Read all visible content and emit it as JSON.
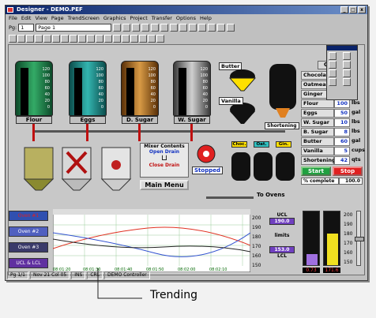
{
  "window": {
    "title": "Designer - DEMO.PEF",
    "min": "_",
    "max": "□",
    "close": "x"
  },
  "menu": [
    "File",
    "Edit",
    "View",
    "Page",
    "TrendScreen",
    "Graphics",
    "Project",
    "Transfer",
    "Options",
    "Help"
  ],
  "toolbar": {
    "page_label": "Pg:",
    "page_num": "1",
    "page_name": "Page 1"
  },
  "tanks": [
    {
      "label": "Flour",
      "color": "#1f7a4a"
    },
    {
      "label": "Eggs",
      "color": "#1b8b88"
    },
    {
      "label": "D. Sugar",
      "color": "#b06a1b"
    },
    {
      "label": "W. Sugar",
      "color": "#7b7b7b"
    }
  ],
  "tank_scale": [
    "120",
    "100",
    "80",
    "60",
    "40",
    "20",
    "0"
  ],
  "butter_label": "Butter",
  "vanilla_label": "Vanilla",
  "shortening_label": "Shortening",
  "mixer": {
    "title": "Mixer Contents",
    "sub": "Open Drain",
    "close": "Close Drain",
    "main_menu": "Main Menu"
  },
  "stopped": "Stopped",
  "silos": [
    "Choc.",
    "Oat.",
    "Gin."
  ],
  "to_ovens": "To Ovens",
  "recipe": {
    "top": "Choco",
    "rows": [
      {
        "n": "Chocolate",
        "v": "",
        "u": ""
      },
      {
        "n": "Oatmeal",
        "v": "",
        "u": ""
      },
      {
        "n": "Ginger",
        "v": "",
        "u": ""
      },
      {
        "n": "Flour",
        "v": "100",
        "u": "lbs"
      },
      {
        "n": "Eggs",
        "v": "50",
        "u": "gal"
      },
      {
        "n": "W. Sugar",
        "v": "10",
        "u": "lbs"
      },
      {
        "n": "B. Sugar",
        "v": "8",
        "u": "lbs"
      },
      {
        "n": "Butter",
        "v": "60",
        "u": "gal"
      },
      {
        "n": "Vanilla",
        "v": "5",
        "u": "cups"
      },
      {
        "n": "Shortening",
        "v": "42",
        "u": "qts"
      }
    ],
    "start": "Start",
    "stop": "Stop",
    "complete_label": "% complete",
    "complete_value": "100.0"
  },
  "trend": {
    "legend": [
      "Oven #1",
      "Oven #2",
      "Oven #3",
      "UCL  &  LCL"
    ],
    "ylabels": [
      "200",
      "190",
      "180",
      "170",
      "160",
      "150"
    ],
    "ucl_label": "UCL",
    "ucl_value": "190.0",
    "limits_label": "limits",
    "lcl_value": "153.0",
    "lcl_label": "LCL",
    "xlabels": [
      "08:01:20",
      "08:01:30",
      "08:01:40",
      "08:01:50",
      "08:02:00",
      "08:02:10",
      "08:02:20"
    ]
  },
  "gauges": {
    "left_value": "0.73",
    "right_value": "171.6",
    "scale": [
      "200",
      "190",
      "180",
      "170",
      "160",
      "150"
    ]
  },
  "statusbar": [
    "Pg 1/1",
    "Nov 21 Col 05",
    "INS",
    "CRL",
    "DEMO Controller"
  ],
  "caption": "Trending"
}
